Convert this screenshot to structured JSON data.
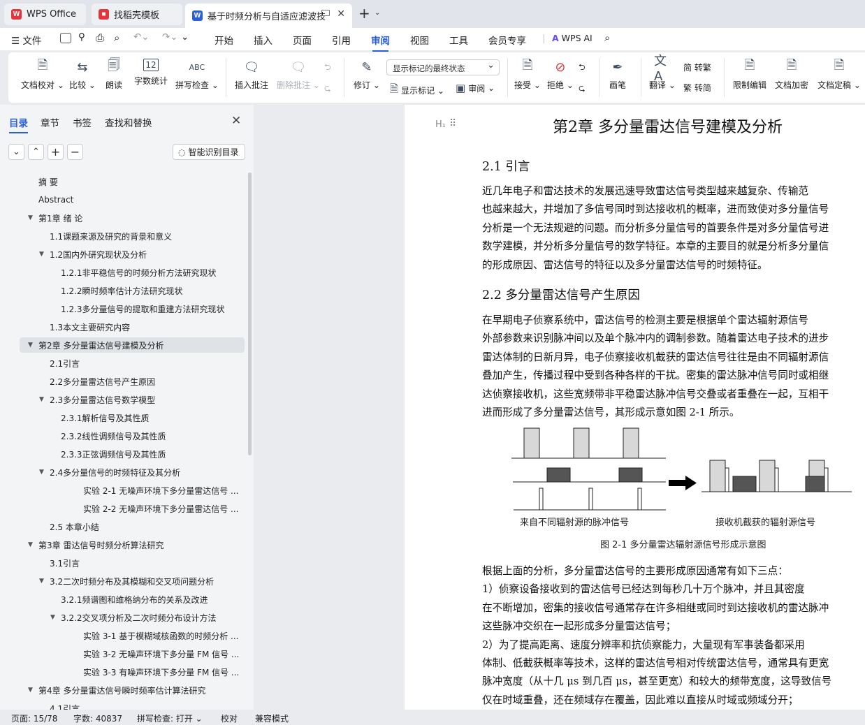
{
  "tabs": {
    "wps": "WPS Office",
    "template": "找稻壳模板",
    "document": "基于时频分析与自适应滤波技",
    "wps_icon": "W",
    "template_icon": "■",
    "doc_icon": "W",
    "new_tab": "+"
  },
  "colors": {
    "accent": "#2b5fd9",
    "wps_red": "#e5343b",
    "doc_blue": "#2b5fd9"
  },
  "menu": {
    "file": "文件",
    "items": [
      "开始",
      "插入",
      "页面",
      "引用",
      "审阅",
      "视图",
      "工具",
      "会员专享"
    ],
    "active": "审阅",
    "ai": "WPS AI"
  },
  "ribbon": {
    "proofread": "文档校对",
    "compare": "比较",
    "read_aloud": "朗读",
    "word_count": "字数统计",
    "spell_check": "拼写检查",
    "spell_icon": "ABC",
    "count_icon": "12",
    "insert_comment": "插入批注",
    "delete_comment": "删除批注",
    "revise": "修订",
    "markup_select": "显示标记的最终状态",
    "show_markup": "显示标记",
    "review": "审阅",
    "accept": "接受",
    "reject": "拒绝",
    "ink": "画笔",
    "translate": "翻译",
    "to_traditional": "简 转繁",
    "to_simplified": "繁 转简",
    "restrict_edit": "限制编辑",
    "doc_encrypt": "文档加密",
    "doc_finalize": "文档定稿"
  },
  "sidebar": {
    "tabs": [
      "目录",
      "章节",
      "书签",
      "查找和替换"
    ],
    "active_tab": "目录",
    "smart_toc": "智能识别目录",
    "toc": [
      {
        "text": "摘  要",
        "level": 0,
        "arrow": false
      },
      {
        "text": "Abstract",
        "level": 0,
        "arrow": false
      },
      {
        "text": "第1章 绪  论",
        "level": 0,
        "arrow": true
      },
      {
        "text": "1.1课题来源及研究的背景和意义",
        "level": 1,
        "arrow": false
      },
      {
        "text": "1.2国内外研究现状及分析",
        "level": 1,
        "arrow": true
      },
      {
        "text": "1.2.1非平稳信号的时频分析方法研究现状",
        "level": 2,
        "arrow": false
      },
      {
        "text": "1.2.2瞬时频率估计方法研究现状",
        "level": 2,
        "arrow": false
      },
      {
        "text": "1.2.3多分量信号的提取和重建方法研究现状",
        "level": 2,
        "arrow": false
      },
      {
        "text": "1.3本文主要研究内容",
        "level": 1,
        "arrow": false
      },
      {
        "text": "第2章 多分量雷达信号建模及分析",
        "level": 0,
        "arrow": true,
        "selected": true
      },
      {
        "text": "2.1引言",
        "level": 1,
        "arrow": false
      },
      {
        "text": "2.2多分量雷达信号产生原因",
        "level": 1,
        "arrow": false
      },
      {
        "text": "2.3多分量雷达信号数学模型",
        "level": 1,
        "arrow": true
      },
      {
        "text": "2.3.1解析信号及其性质",
        "level": 2,
        "arrow": false
      },
      {
        "text": "2.3.2线性调频信号及其性质",
        "level": 2,
        "arrow": false
      },
      {
        "text": "2.3.3正弦调频信号及其性质",
        "level": 2,
        "arrow": false
      },
      {
        "text": "2.4多分量信号的时频特征及其分析",
        "level": 1,
        "arrow": true
      },
      {
        "text": "实验  2-1 无噪声环境下多分量雷达信号 ...",
        "level": 3,
        "arrow": false
      },
      {
        "text": "实验  2-2 无噪声环境下多分量雷达信号 ...",
        "level": 3,
        "arrow": false
      },
      {
        "text": "2.5 本章小结",
        "level": 1,
        "arrow": false
      },
      {
        "text": "第3章 雷达信号时频分析算法研究",
        "level": 0,
        "arrow": true
      },
      {
        "text": "3.1引言",
        "level": 1,
        "arrow": false
      },
      {
        "text": "3.2二次时频分布及其模糊和交叉项问题分析",
        "level": 1,
        "arrow": true
      },
      {
        "text": "3.2.1频谱图和维格纳分布的关系及改进",
        "level": 2,
        "arrow": false
      },
      {
        "text": "3.2.2交叉项分析及二次时频分布设计方法",
        "level": 2,
        "arrow": true
      },
      {
        "text": "实验  3-1 基于模糊域核函数的时频分析 ...",
        "level": 3,
        "arrow": false
      },
      {
        "text": "实验  3-2 无噪声环境下多分量  FM  信号 ...",
        "level": 3,
        "arrow": false
      },
      {
        "text": "实验  3-3 有噪声环境下多分量  FM  信号 ...",
        "level": 3,
        "arrow": false
      },
      {
        "text": "第4章 多分量雷达信号瞬时频率估计算法研究",
        "level": 0,
        "arrow": true
      },
      {
        "text": "4.1引言",
        "level": 1,
        "arrow": false
      }
    ]
  },
  "document": {
    "heading_marker": "H₁",
    "chapter_title": "第2章  多分量雷达信号建模及分析",
    "sec1_title": "2.1  引言",
    "sec1_paragraph": [
      "    近几年电子和雷达技术的发展迅速导致雷达信号类型越来越复杂、传输范",
      "也越来越大，并增加了多信号同时到达接收机的概率，进而致使对多分量信号",
      "分析是一个无法规避的问题。而分析多分量信号的首要条件是对多分量信号进",
      "数学建模，并分析多分量信号的数学特征。本章的主要目的就是分析多分量信",
      "的形成原因、雷达信号的特征以及多分量雷达信号的时频特征。"
    ],
    "sec2_title": "2.2  多分量雷达信号产生原因",
    "sec2_paragraph": [
      "    在早期电子侦察系统中，雷达信号的检测主要是根据单个雷达辐射源信号",
      "外部参数来识别脉冲间以及单个脉冲内的调制参数。随着雷达电子技术的进步",
      "雷达体制的日新月异，电子侦察接收机截获的雷达信号往往是由不同辐射源信",
      "叠加产生，传播过程中受到各种各样的干扰。密集的雷达脉冲信号同时或相继",
      "达侦察接收机，这些宽频带非平稳雷达脉冲信号交叠或者重叠在一起，互相干",
      "进而形成了多分量雷达信号，其形成示意如图  2-1 所示。"
    ],
    "figure": {
      "left_label": "来自不同辐射源的脉冲信号",
      "right_label": "接收机截获的辐射源信号",
      "caption": "图  2-1 多分量雷达辐射源信号形成示意图"
    },
    "after_paragraph": [
      "    根据上面的分析，多分量雷达信号的主要形成原因通常有如下三点：",
      "    1）侦察设备接收到的雷达信号已经达到每秒几十万个脉冲，并且其密度",
      "在不断增加，密集的接收信号通常存在许多相继或同时到达接收机的雷达脉冲",
      "这些脉冲交织在一起形成多分量雷达信号；",
      "    2）为了提高距离、速度分辨率和抗侦察能力，大量现有军事装备都采用",
      "体制、低截获概率等技术，这样的雷达信号相对传统雷达信号，通常具有更宽",
      "脉冲宽度（从十几  μs 到几百  μs，甚至更宽）和较大的频带宽度，这导致信号",
      "仅在时域重叠，还在频域存在覆盖，因此难以直接从时域或频域分开；"
    ]
  },
  "status": {
    "page": "页面: 15/78",
    "words": "字数: 40837",
    "spell": "拼写检查: 打开",
    "proof": "校对",
    "compat": "兼容模式"
  }
}
